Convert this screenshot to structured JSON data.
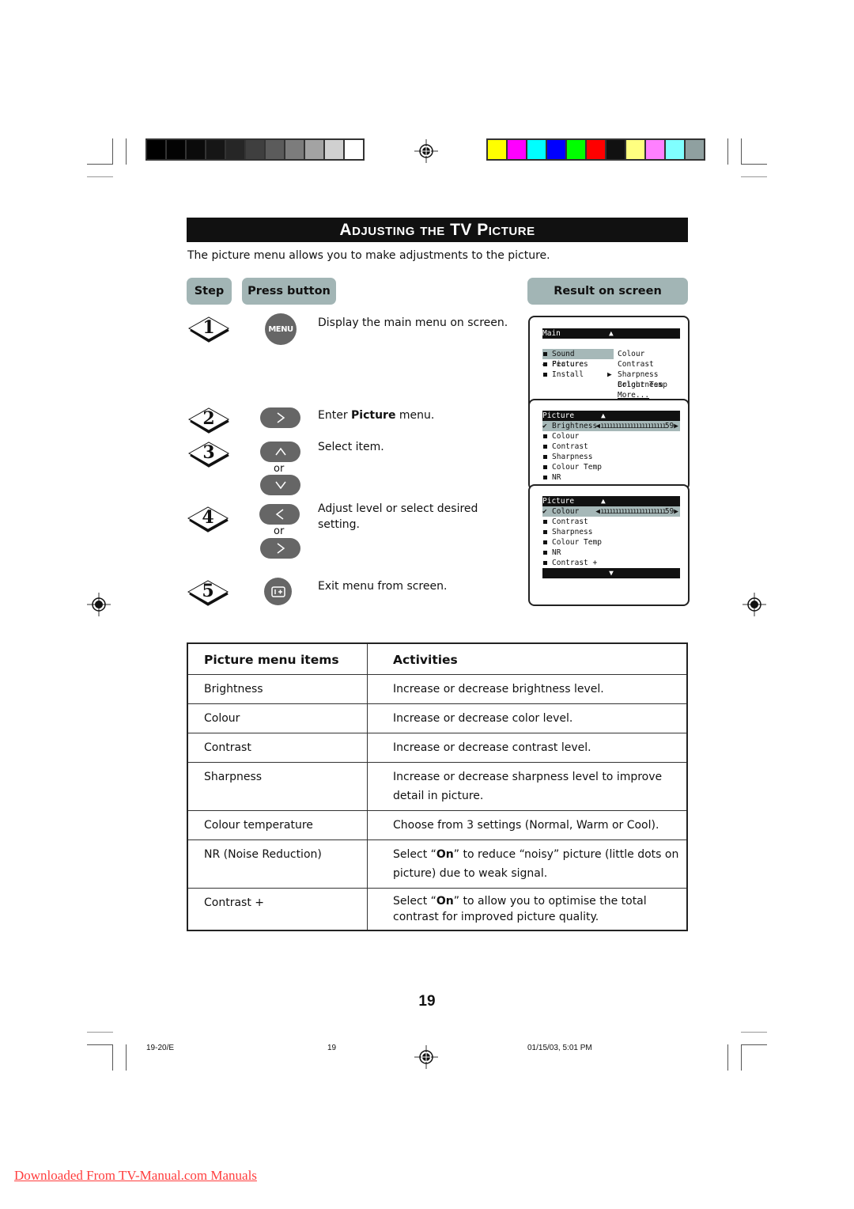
{
  "colors": {
    "grayscale_swatches": [
      "#000000",
      "#030303",
      "#0b0b0b",
      "#161616",
      "#262626",
      "#3f3f3f",
      "#5b5b5b",
      "#7c7c7c",
      "#a3a3a3",
      "#d0d0d0",
      "#ffffff"
    ],
    "color_swatches": [
      "#ffff00",
      "#ff00ff",
      "#00ffff",
      "#0000ff",
      "#00ff00",
      "#ff0000",
      "#111111",
      "#ffff80",
      "#ff80ff",
      "#80ffff",
      "#8fa0a0"
    ],
    "header_pill": "#a2b5b5",
    "button_gray": "#666666",
    "link": "#ff3d3d"
  },
  "title": "Adjusting the TV Picture",
  "intro": "The picture menu allows you to make adjustments to the picture.",
  "columns": {
    "step": "Step",
    "press_button": "Press button",
    "result": "Result on screen"
  },
  "steps": [
    {
      "num": "1",
      "button": "MENU",
      "button_icon": "menu-button",
      "text": "Display the main menu on screen."
    },
    {
      "num": "2",
      "button_icon": "right-arrow-button",
      "text_pre": "Enter ",
      "text_bold": "Picture",
      "text_post": " menu."
    },
    {
      "num": "3",
      "button_icon": "up-down-arrow-buttons",
      "or": "or",
      "text": "Select item."
    },
    {
      "num": "4",
      "button_icon": "left-right-arrow-buttons",
      "or": "or",
      "text": "Adjust level or select desired setting."
    },
    {
      "num": "5",
      "button_icon": "osd-info-button",
      "text": "Exit menu from screen."
    }
  ],
  "osd": {
    "screen1": {
      "header": "Main",
      "left_items": [
        {
          "label": "Picture",
          "selected": true
        },
        {
          "label": "Sound"
        },
        {
          "label": "Features"
        },
        {
          "label": "Install"
        }
      ],
      "right_items": [
        "Brightness",
        "Colour",
        "Contrast",
        "Sharpness",
        "Colour Temp",
        "More..."
      ]
    },
    "screen2": {
      "header": "Picture",
      "selected": {
        "label": "Brightness",
        "value": "59"
      },
      "items": [
        "Colour",
        "Contrast",
        "Sharpness",
        "Colour Temp",
        "NR"
      ]
    },
    "screen3": {
      "header": "Picture",
      "selected": {
        "label": "Colour",
        "value": "59"
      },
      "items": [
        "Contrast",
        "Sharpness",
        "Colour Temp",
        "NR",
        "Contrast +"
      ]
    }
  },
  "table": {
    "headers": [
      "Picture menu items",
      "Activities"
    ],
    "rows": [
      {
        "item": "Brightness",
        "activity": "Increase or decrease brightness level."
      },
      {
        "item": "Colour",
        "activity": "Increase or decrease color level."
      },
      {
        "item": "Contrast",
        "activity": "Increase or decrease contrast level."
      },
      {
        "item": "Sharpness",
        "activity": "Increase or decrease sharpness level to improve detail in picture."
      },
      {
        "item": "Colour temperature",
        "activity": "Choose from 3 settings (Normal, Warm or Cool)."
      },
      {
        "item": "NR (Noise Reduction)",
        "activity_pre": "Select “",
        "activity_bold": "On",
        "activity_post": "” to reduce “noisy” picture (little dots on picture) due to weak signal."
      },
      {
        "item": "Contrast +",
        "activity_pre": "Select “",
        "activity_bold": "On",
        "activity_post": "” to allow you to optimise the total contrast for improved picture quality."
      }
    ]
  },
  "page_number": "19",
  "footer": {
    "left": "19-20/E",
    "middle": "19",
    "right": "01/15/03, 5:01 PM"
  },
  "download_link": "Downloaded From TV-Manual.com Manuals"
}
